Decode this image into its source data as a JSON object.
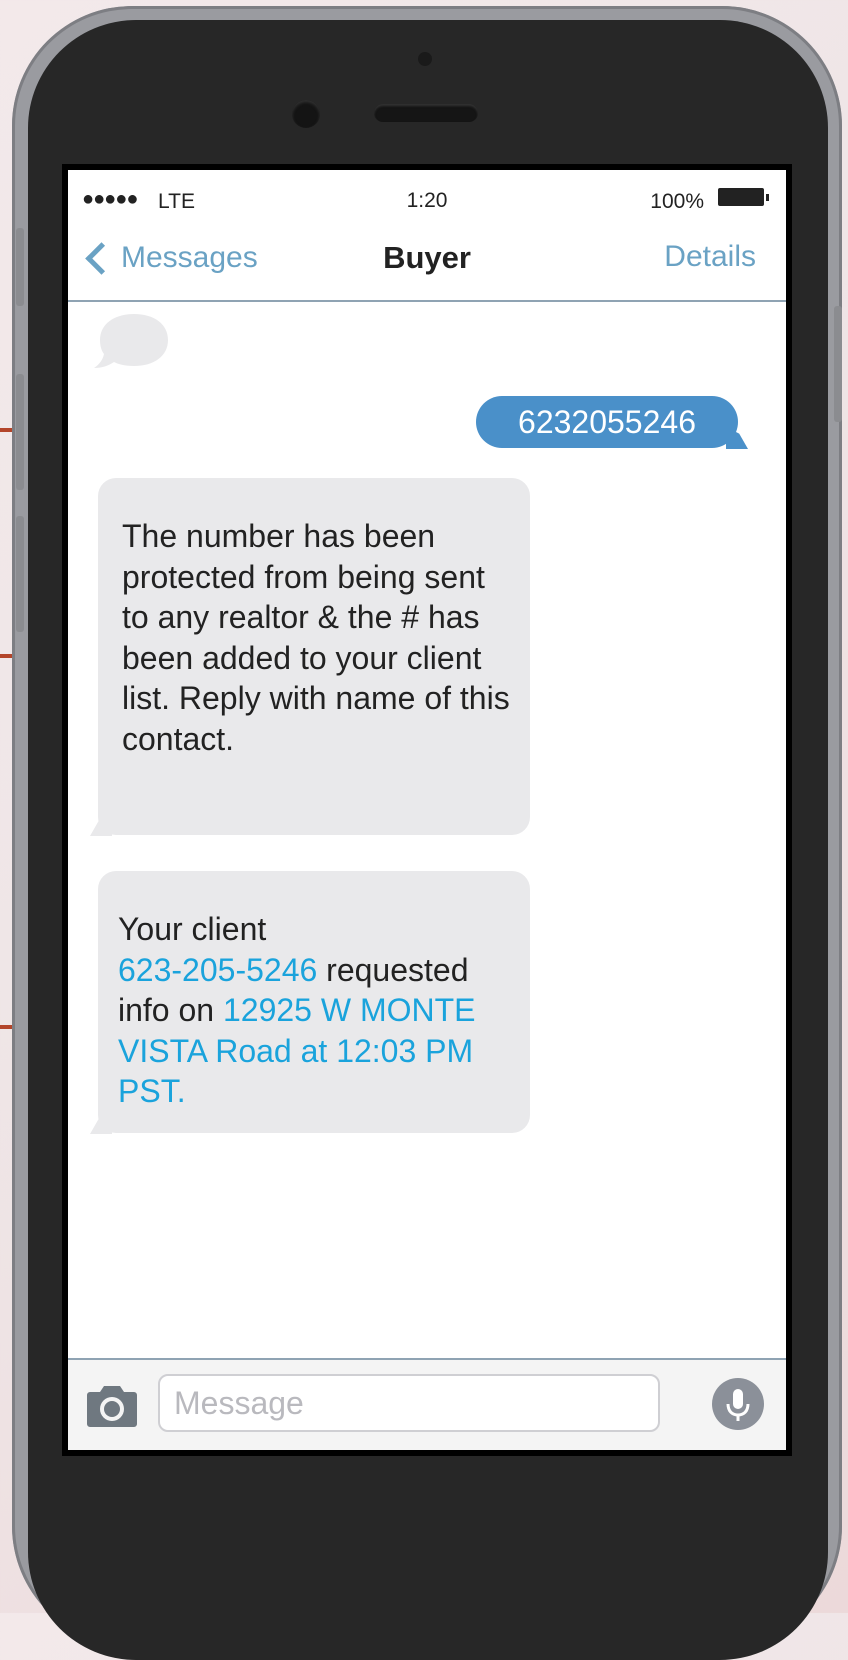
{
  "status_bar": {
    "signal": "●●●●●",
    "carrier": "LTE",
    "time": "1:20",
    "battery_percent": "100%"
  },
  "nav": {
    "back_label": "Messages",
    "title": "Buyer",
    "details_label": "Details"
  },
  "messages": {
    "outgoing": "6232055246",
    "incoming_1": "The number has been protected from being sent to any realtor & the # has been added to your client list. Reply with name of this contact.",
    "incoming_2": {
      "prefix": "Your client",
      "phone_link": "623-205-5246",
      "middle": " requested info on ",
      "address_link": "12925 W MONTE VISTA Road at 12:03 PM PST."
    }
  },
  "input": {
    "placeholder": "Message"
  },
  "colors": {
    "accent": "#6aa2c4",
    "outgoing_bubble": "#4a90c9",
    "incoming_bubble": "#e9e9eb",
    "link": "#1aa3dc",
    "callout_line": "#b3452a"
  },
  "icons": [
    "back-chevron-icon",
    "typing-indicator-icon",
    "camera-icon",
    "microphone-icon",
    "battery-icon"
  ]
}
